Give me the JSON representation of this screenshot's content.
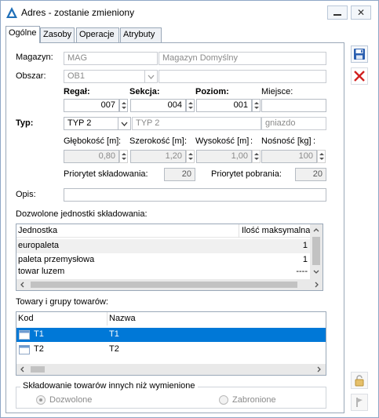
{
  "window": {
    "title": "Adres - zostanie zmieniony",
    "minimize_icon": "minimize-icon",
    "close_icon": "close-icon"
  },
  "tabs": [
    {
      "label": "Ogólne",
      "active": true
    },
    {
      "label": "Zasoby",
      "active": false
    },
    {
      "label": "Operacje",
      "active": false
    },
    {
      "label": "Atrybuty",
      "active": false
    }
  ],
  "form": {
    "magazyn_label": "Magazyn:",
    "magazyn_code": "MAG",
    "magazyn_name": "Magazyn Domyślny",
    "obszar_label": "Obszar:",
    "obszar_value": "OB1",
    "obszar_extra": "",
    "regal_label": "Regał:",
    "regal_value": "007",
    "sekcja_label": "Sekcja:",
    "sekcja_value": "004",
    "poziom_label": "Poziom:",
    "poziom_value": "001",
    "miejsce_label": "Miejsce:",
    "miejsce_value": "",
    "typ_label": "Typ:",
    "typ_value": "TYP 2",
    "typ_name": "TYP 2",
    "typ_kind": "gniazdo",
    "glebokosc_label": "Głębokość [m]",
    "glebokosc_value": "0,80",
    "szerokosc_label": "Szerokość [m]",
    "szerokosc_value": "1,20",
    "wysokosc_label": "Wysokość [m]",
    "wysokosc_value": "1,00",
    "nosnosc_label": "Nośność [kg]",
    "nosnosc_value": "100",
    "colon": ":",
    "priorytet_skl_label": "Priorytet składowania:",
    "priorytet_skl_value": "20",
    "priorytet_pob_label": "Priorytet pobrania:",
    "priorytet_pob_value": "20",
    "opis_label": "Opis:",
    "opis_value": ""
  },
  "units": {
    "section_label": "Dozwolone jednostki składowania:",
    "columns": [
      "Jednostka",
      "Ilość maksymalna"
    ],
    "rows": [
      {
        "unit": "europaleta",
        "max": "1"
      },
      {
        "unit": "paleta przemysłowa",
        "max": "1"
      },
      {
        "unit": "towar luzem",
        "max": "----"
      }
    ]
  },
  "goods": {
    "section_label": "Towary i grupy towarów:",
    "columns": [
      "Kod",
      "Nazwa"
    ],
    "rows": [
      {
        "code": "T1",
        "name": "T1",
        "selected": true
      },
      {
        "code": "T2",
        "name": "T2",
        "selected": false
      }
    ]
  },
  "storage_other": {
    "legend": "Składowanie towarów innych niż wymienione",
    "allowed_label": "Dozwolone",
    "forbidden_label": "Zabronione",
    "selected": "allowed"
  },
  "colors": {
    "selection": "#0078d7",
    "accent": "#1a5fa8",
    "delete_red": "#d02020"
  }
}
